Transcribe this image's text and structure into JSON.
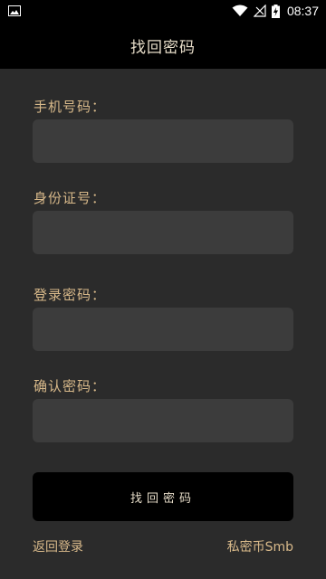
{
  "status_bar": {
    "time": "08:37",
    "icons": [
      "image-icon",
      "wifi-icon",
      "no-signal-icon",
      "battery-charging-icon"
    ]
  },
  "header": {
    "title": "找回密码"
  },
  "form": {
    "phone_label": "手机号码：",
    "phone_value": "",
    "id_label": "身份证号：",
    "id_value": "",
    "login_password_label": "登录密码：",
    "login_password_value": "",
    "confirm_password_label": "确认密码：",
    "confirm_password_value": "",
    "submit_label": "找回密码"
  },
  "footer": {
    "back_to_login": "返回登录",
    "private_coin": "私密币Smb"
  },
  "colors": {
    "background": "#2b2b2b",
    "bar": "#000000",
    "label": "#d8b98a",
    "input_bg": "#3c3c3c",
    "title_text": "#e6dcc8"
  }
}
